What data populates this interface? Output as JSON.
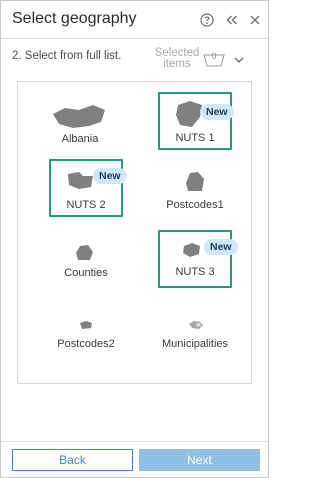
{
  "header": {
    "title": "Select geography",
    "help_icon": "help-circle-icon",
    "collapse_icon": "double-chevron-left-icon",
    "close_icon": "close-icon"
  },
  "step": {
    "label": "2.  Select from full list.",
    "selected_line1": "Selected",
    "selected_line2": "items",
    "selected_count": "0",
    "dropdown_icon": "chevron-down-icon"
  },
  "tiles": [
    {
      "label": "Albania",
      "badge": "",
      "highlighted": false
    },
    {
      "label": "NUTS 1",
      "badge": "New",
      "highlighted": true
    },
    {
      "label": "NUTS 2",
      "badge": "New",
      "highlighted": true
    },
    {
      "label": "Postcodes1",
      "badge": "",
      "highlighted": false
    },
    {
      "label": "Counties",
      "badge": "",
      "highlighted": false
    },
    {
      "label": "NUTS 3",
      "badge": "New",
      "highlighted": true
    },
    {
      "label": "Postcodes2",
      "badge": "",
      "highlighted": false
    },
    {
      "label": "Municipalities",
      "badge": "",
      "highlighted": false
    }
  ],
  "footer": {
    "back_label": "Back",
    "next_label": "Next"
  },
  "colors": {
    "highlight": "#1a9e7c",
    "badge_bg": "#cfe8fb",
    "primary": "#3e84c4",
    "primary_disabled": "#8fbfe3",
    "shape_fill": "#808080"
  }
}
